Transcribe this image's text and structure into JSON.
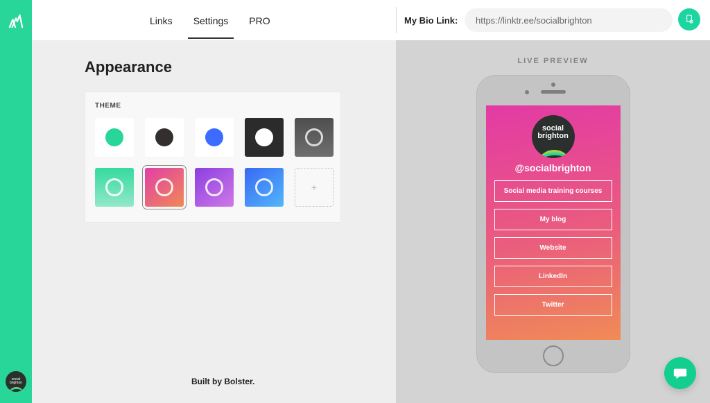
{
  "nav": {
    "tabs": [
      "Links",
      "Settings",
      "PRO"
    ],
    "active_index": 1
  },
  "bio_link": {
    "label": "My Bio Link:",
    "url": "https://linktr.ee/socialbrighton"
  },
  "page": {
    "heading": "Appearance",
    "panel_title": "THEME",
    "footer": "Built by Bolster."
  },
  "themes": [
    {
      "id": "mint",
      "shape": "dot",
      "label": "mint-solid"
    },
    {
      "id": "dark",
      "shape": "dot",
      "label": "dark-solid"
    },
    {
      "id": "blue",
      "shape": "dot",
      "label": "blue-solid"
    },
    {
      "id": "bw",
      "shape": "dot",
      "label": "black-white"
    },
    {
      "id": "grey",
      "shape": "ring",
      "label": "grey-gradient"
    },
    {
      "id": "mintg",
      "shape": "ring",
      "label": "mint-gradient"
    },
    {
      "id": "pinkg",
      "shape": "ring",
      "label": "pink-gradient",
      "selected": true
    },
    {
      "id": "purpg",
      "shape": "ring",
      "label": "purple-gradient"
    },
    {
      "id": "blueg",
      "shape": "ring",
      "label": "blue-gradient"
    },
    {
      "id": "add",
      "shape": "plus",
      "label": "add-theme"
    }
  ],
  "preview": {
    "label": "LIVE PREVIEW",
    "profile_name_line1": "social",
    "profile_name_line2": "brighton",
    "handle": "@socialbrighton",
    "links": [
      "Social media training courses",
      "My blog",
      "Website",
      "LinkedIn",
      "Twitter"
    ]
  }
}
